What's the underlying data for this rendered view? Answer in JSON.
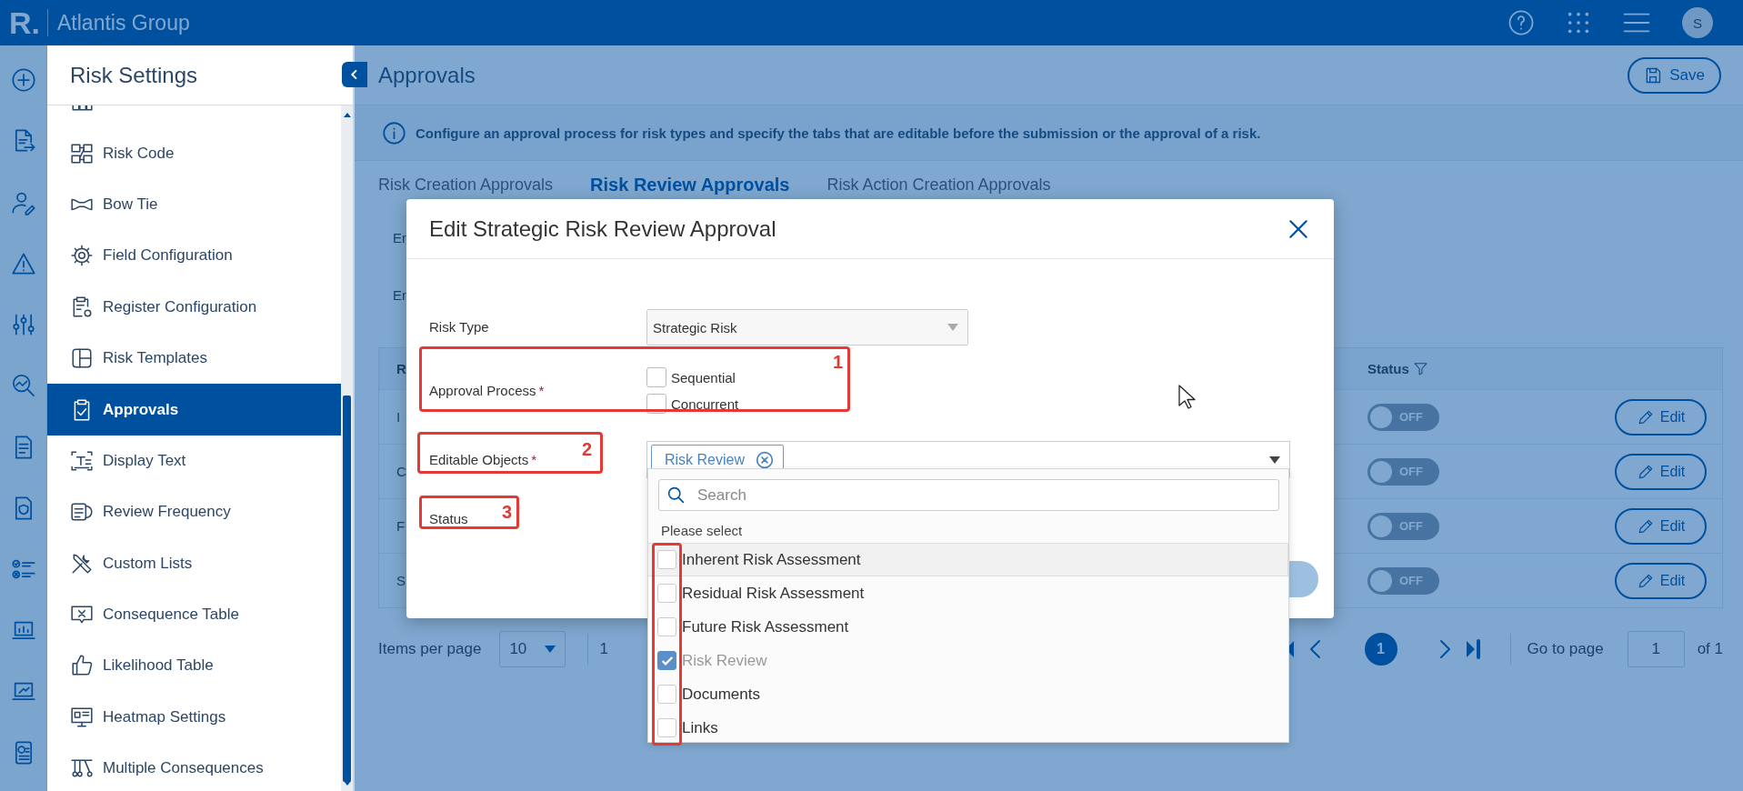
{
  "header": {
    "logo": "R.",
    "title": "Atlantis Group",
    "avatar": "S"
  },
  "sidebar": {
    "title": "Risk Settings",
    "items": [
      {
        "label": "Risk Code",
        "selected": false
      },
      {
        "label": "Bow Tie",
        "selected": false
      },
      {
        "label": "Field Configuration",
        "selected": false
      },
      {
        "label": "Register Configuration",
        "selected": false
      },
      {
        "label": "Risk Templates",
        "selected": false
      },
      {
        "label": "Approvals",
        "selected": true
      },
      {
        "label": "Display Text",
        "selected": false
      },
      {
        "label": "Review Frequency",
        "selected": false
      },
      {
        "label": "Custom Lists",
        "selected": false
      },
      {
        "label": "Consequence Table",
        "selected": false
      },
      {
        "label": "Likelihood Table",
        "selected": false
      },
      {
        "label": "Heatmap Settings",
        "selected": false
      },
      {
        "label": "Multiple Consequences",
        "selected": false
      }
    ]
  },
  "page": {
    "title": "Approvals",
    "save_button": "Save",
    "info": "Configure an approval process for risk types and specify the tabs that are editable before the submission or the approval of a risk.",
    "tabs": [
      {
        "label": "Risk Creation Approvals",
        "selected": false
      },
      {
        "label": "Risk Review Approvals",
        "selected": true
      },
      {
        "label": "Risk Action Creation Approvals",
        "selected": false
      }
    ],
    "filter_labels": [
      "En",
      "En"
    ],
    "table": {
      "columns": [
        "R",
        "Status"
      ],
      "rows": [
        {
          "name": "I",
          "status": "OFF",
          "on": false,
          "action": "Edit"
        },
        {
          "name": "C",
          "status": "OFF",
          "on": false,
          "action": "Edit"
        },
        {
          "name": "F",
          "status": "OFF",
          "on": false,
          "action": "Edit"
        },
        {
          "name": "S",
          "status": "OFF",
          "on": false,
          "action": "Edit"
        }
      ]
    },
    "pagination": {
      "label": "Items per page",
      "per_page": "10",
      "range": "1",
      "current_page": "1",
      "goto_label": "Go to page",
      "goto_value": "1",
      "total": "of 1"
    }
  },
  "modal": {
    "title": "Edit Strategic Risk Review Approval",
    "fields": [
      {
        "kind": "select",
        "label": "Risk Type",
        "value": "Strategic Risk"
      },
      {
        "kind": "checkboxes",
        "label": "Approval Process",
        "marker": "*",
        "options": [
          {
            "label": "Sequential",
            "checked": false
          },
          {
            "label": "Concurrent",
            "checked": false
          }
        ]
      },
      {
        "kind": "multiselect",
        "label": "Editable Objects",
        "marker": "*",
        "chips": [
          "Risk Review"
        ]
      },
      {
        "kind": "label",
        "label": "Status"
      }
    ],
    "dropdown": {
      "placeholder": "Search",
      "hint": "Please select",
      "options": [
        {
          "label": "Inherent Risk Assessment",
          "checked": false,
          "hovered": true
        },
        {
          "label": "Residual Risk Assessment",
          "checked": false,
          "hovered": false
        },
        {
          "label": "Future Risk Assessment",
          "checked": false,
          "hovered": false
        },
        {
          "label": "Risk Review",
          "checked": true,
          "hovered": false
        },
        {
          "label": "Documents",
          "checked": false,
          "hovered": false
        },
        {
          "label": "Links",
          "checked": false,
          "hovered": false
        }
      ]
    }
  },
  "annotations": [
    {
      "number": "1"
    },
    {
      "number": "2"
    },
    {
      "number": "3"
    }
  ]
}
